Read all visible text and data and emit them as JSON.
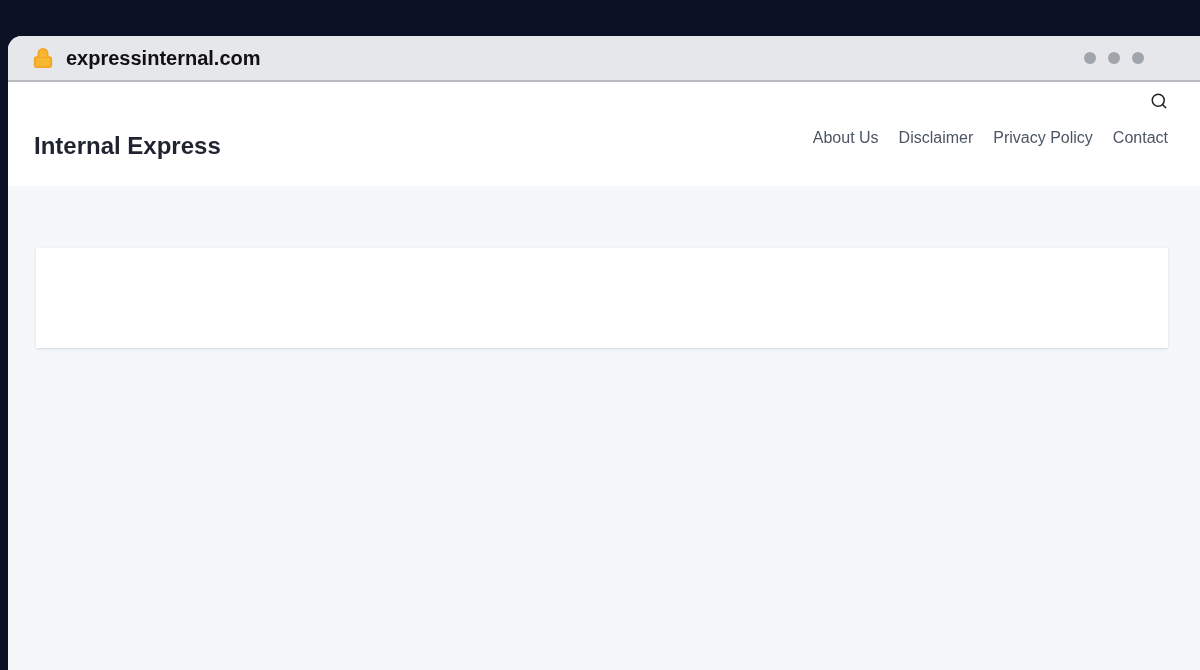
{
  "browser": {
    "url": "expressinternal.com"
  },
  "site": {
    "title": "Internal Express",
    "nav": [
      {
        "label": "About Us"
      },
      {
        "label": "Disclaimer"
      },
      {
        "label": "Privacy Policy"
      },
      {
        "label": "Contact"
      }
    ]
  }
}
